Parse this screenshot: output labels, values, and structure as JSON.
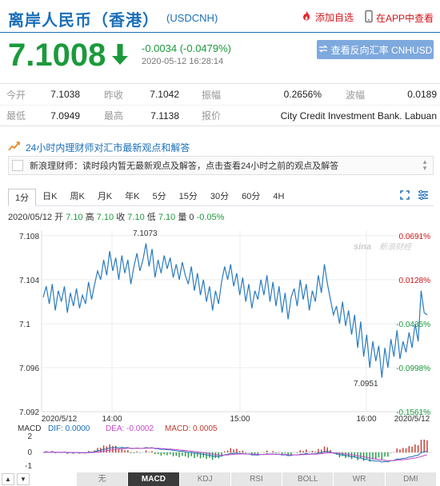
{
  "header": {
    "title": "离岸人民币（香港）",
    "code": "(USDCNH)",
    "add_watch": "添加自选",
    "app_view": "在APP中查看"
  },
  "quote": {
    "price": "7.1008",
    "change": "-0.0034 (-0.0479%)",
    "timestamp": "2020-05-12 16:28:14",
    "reverse_button": "查看反向汇率 CNHUSD",
    "rows": [
      [
        {
          "label": "今开",
          "value": "7.1038"
        },
        {
          "label": "昨收",
          "value": "7.1042"
        },
        {
          "label": "振幅",
          "value": "0.2656%"
        },
        {
          "label": "波幅",
          "value": "0.0189"
        }
      ],
      [
        {
          "label": "最低",
          "value": "7.0949"
        },
        {
          "label": "最高",
          "value": "7.1138"
        },
        {
          "label": "报价",
          "value": "City Credit Investment Bank. Labuan"
        }
      ]
    ]
  },
  "news": {
    "heading": "24小时内理财师对汇市最新观点和解答",
    "message": "新浪理财师：读时段内暂无最新观点及解答，点击查看24小时之前的观点及解答"
  },
  "tabs": [
    "1分",
    "日K",
    "周K",
    "月K",
    "年K",
    "5分",
    "15分",
    "30分",
    "60分",
    "4H"
  ],
  "active_tab": 0,
  "ohlc": {
    "date": "2020/05/12",
    "open_label": "开",
    "open": "7.10",
    "high_label": "高",
    "high": "7.10",
    "close_label": "收",
    "close": "7.10",
    "low_label": "低",
    "low": "7.10",
    "vol_label": "量",
    "vol": "0",
    "pct": "-0.05%"
  },
  "chart_data": {
    "type": "line",
    "watermark": "新浪财经",
    "y_ticks": [
      "7.108",
      "7.104",
      "7.1",
      "7.096",
      "7.092"
    ],
    "pct_ticks": [
      "0.0691%",
      "0.0128%",
      "-0.0435%",
      "-0.0998%",
      "-0.1561%"
    ],
    "x_ticks": [
      "2020/5/12",
      "14:00",
      "15:00",
      "16:00",
      "2020/5/12"
    ],
    "ylim": [
      7.092,
      7.1085
    ],
    "high_label": "7.1073",
    "low_label": "7.0951",
    "values": [
      7.1024,
      7.1034,
      7.1018,
      7.1036,
      7.1012,
      7.103,
      7.102,
      7.1034,
      7.101,
      7.1028,
      7.1016,
      7.1032,
      7.1014,
      7.1026,
      7.1018,
      7.1038,
      7.1022,
      7.1036,
      7.1048,
      7.104,
      7.1058,
      7.1044,
      7.1066,
      7.1048,
      7.106,
      7.104,
      7.1062,
      7.1046,
      7.1058,
      7.1036,
      7.1052,
      7.1064,
      7.1048,
      7.1058,
      7.1073,
      7.1052,
      7.1068,
      7.1042,
      7.1058,
      7.1046,
      7.1062,
      7.105,
      7.106,
      7.1042,
      7.1054,
      7.104,
      7.1056,
      7.1044,
      7.1036,
      7.1052,
      7.103,
      7.1046,
      7.1026,
      7.104,
      7.102,
      7.1034,
      7.1012,
      7.103,
      7.1018,
      7.1038,
      7.1052,
      7.104,
      7.1054,
      7.1034,
      7.1046,
      7.1026,
      7.1042,
      7.102,
      7.1036,
      7.1014,
      7.103,
      7.1022,
      7.104,
      7.1026,
      7.1044,
      7.102,
      7.1038,
      7.1016,
      7.1034,
      7.101,
      7.1028,
      7.1004,
      7.1024,
      7.1032,
      7.1016,
      7.104,
      7.1022,
      7.1036,
      7.1012,
      7.103,
      7.102,
      7.1044,
      7.1028,
      7.1054,
      7.1036,
      7.1022,
      7.1008,
      7.1016,
      7.1,
      7.102,
      7.0998,
      7.1012,
      7.099,
      7.1008,
      7.0978,
      7.1002,
      7.097,
      7.099,
      7.096,
      7.0984,
      7.0966,
      7.098,
      7.0951,
      7.0978,
      7.096,
      7.0986,
      7.097,
      7.0994,
      7.0968,
      7.0984,
      7.0974,
      7.0992,
      7.0978,
      7.1,
      7.0984,
      7.103,
      7.101,
      7.1008
    ]
  },
  "macd": {
    "label": "MACD",
    "dif": "DIF: 0.0000",
    "dea": "DEA: -0.0002",
    "macd": "MACD: 0.0005",
    "y_ticks": [
      "2",
      "0",
      "-1"
    ],
    "dif_color": "#1b6fb8",
    "dea_color": "#c34ac8",
    "up_color": "#c0392b",
    "down_color": "#1b9a3c"
  },
  "bottom_tabs": [
    "无",
    "MACD",
    "KDJ",
    "RSI",
    "BOLL",
    "WR",
    "DMI"
  ],
  "active_bottom_tab": 1,
  "colors": {
    "brand": "#1b6fb8",
    "down": "#1b9a3c",
    "red": "#d0161b",
    "line": "#2a7bbf"
  }
}
